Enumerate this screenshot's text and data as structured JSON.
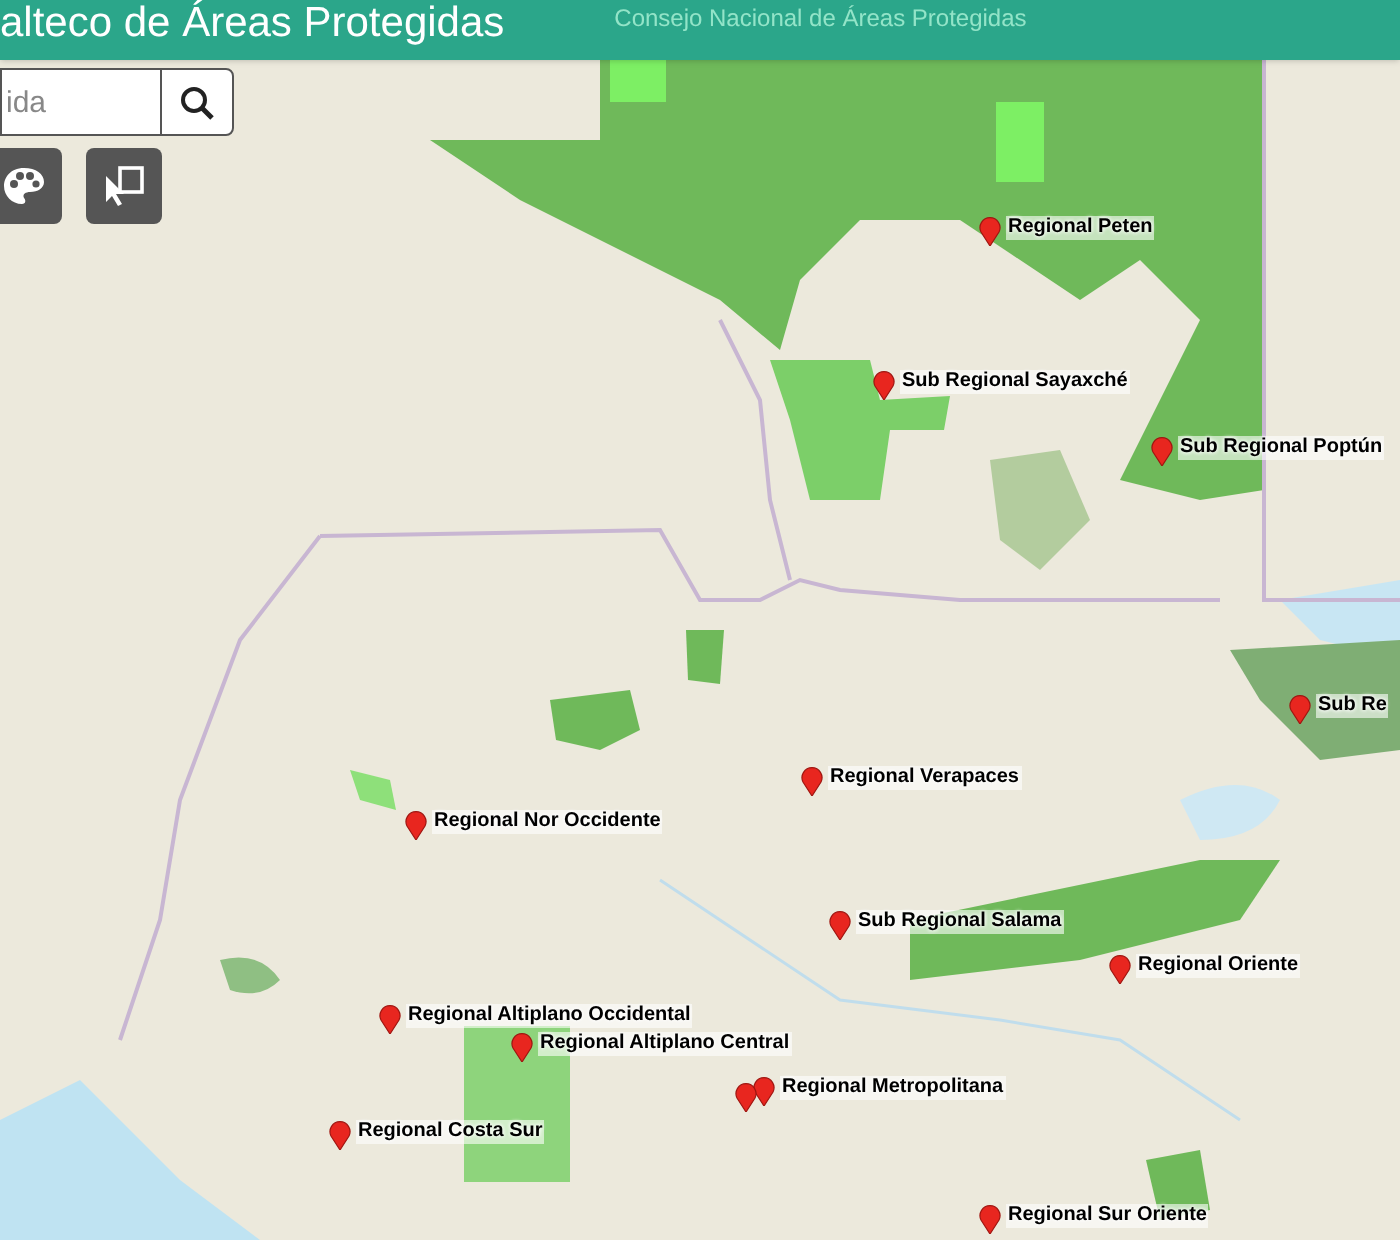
{
  "header": {
    "title": "alteco de Áreas Protegidas",
    "subtitle": "Consejo Nacional de Áreas Protegidas"
  },
  "search": {
    "placeholder": "ida"
  },
  "tools": [
    {
      "kind": "palette"
    },
    {
      "kind": "select"
    }
  ],
  "pins": [
    {
      "kind": "labeled",
      "label": "Regional Peten"
    },
    {
      "kind": "labeled",
      "label": "Sub Regional Sayaxché"
    },
    {
      "kind": "labeled",
      "label": "Sub Regional Poptún"
    },
    {
      "kind": "labeled",
      "label": "Sub Re"
    },
    {
      "kind": "labeled",
      "label": "Regional Verapaces"
    },
    {
      "kind": "labeled",
      "label": "Regional Nor Occidente"
    },
    {
      "kind": "labeled",
      "label": "Sub Regional Salama"
    },
    {
      "kind": "labeled",
      "label": "Regional Oriente"
    },
    {
      "kind": "labeled",
      "label": "Regional Altiplano Occidental"
    },
    {
      "kind": "labeled",
      "label": "Regional Altiplano Central"
    },
    {
      "kind": "labeled",
      "label": "Regional Metropolitana"
    },
    {
      "kind": "labeled",
      "label": "Regional Costa Sur"
    },
    {
      "kind": "labeled",
      "label": "Regional Sur Oriente"
    },
    {
      "kind": "bare"
    }
  ]
}
